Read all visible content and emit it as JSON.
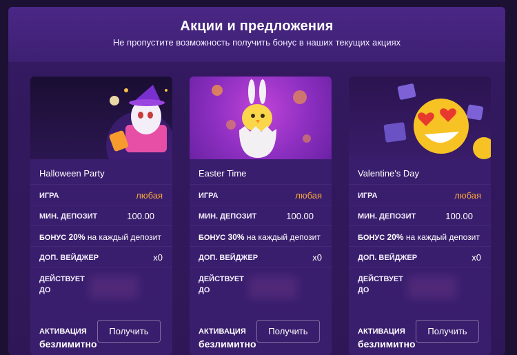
{
  "header": {
    "title": "Акции и предложения",
    "subtitle": "Не пропустите возможность получить бонус в наших текущих акциях"
  },
  "labels": {
    "game": "ИГРА",
    "min_deposit": "МИН. ДЕПОЗИТ",
    "bonus": "БОНУС",
    "wager": "ДОП. ВЕЙДЖЕР",
    "valid_line1": "ДЕЙСТВУЕТ",
    "valid_line2": "ДО",
    "activation": "АКТИВАЦИЯ"
  },
  "cards": [
    {
      "title": "Halloween Party",
      "game": "любая",
      "min_deposit": "100.00",
      "bonus_pct": "20%",
      "bonus_text": "на каждый депозит",
      "wager": "x0",
      "activation": "безлимитно",
      "button": "Получить",
      "banner_icon": "halloween-ghost-icon"
    },
    {
      "title": "Easter Time",
      "game": "любая",
      "min_deposit": "100.00",
      "bonus_pct": "30%",
      "bonus_text": "на каждый депозит",
      "wager": "x0",
      "activation": "безлимитно",
      "button": "Получить",
      "banner_icon": "easter-chick-icon"
    },
    {
      "title": "Valentine's Day",
      "game": "любая",
      "min_deposit": "100.00",
      "bonus_pct": "20%",
      "bonus_text": "на каждый депозит",
      "wager": "x0",
      "activation": "безлимитно",
      "button": "Получить",
      "banner_icon": "heart-eyes-emoji-icon"
    }
  ],
  "colors": {
    "accent_orange": "#f6a53a",
    "card_bg": "#3a1e6e",
    "panel_bg": "#33195f"
  }
}
